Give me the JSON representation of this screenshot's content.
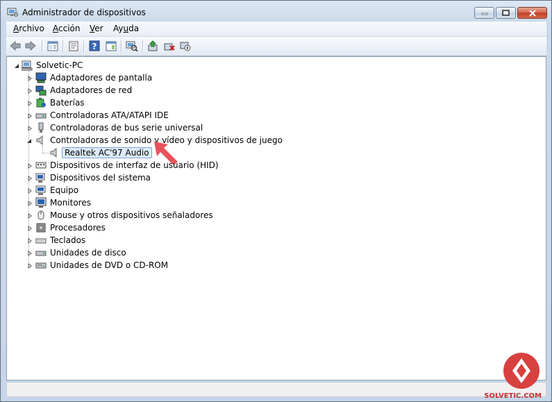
{
  "window": {
    "title": "Administrador de dispositivos",
    "accent": "#c6d6e8"
  },
  "menu": {
    "file": "Archivo",
    "action": "Acción",
    "view": "Ver",
    "help": "Ayuda"
  },
  "toolbar": {
    "icons": [
      "back-icon",
      "forward-icon",
      "show-hide-console-tree-icon",
      "properties-icon",
      "help-icon",
      "action-pane-icon",
      "scan-hardware-icon",
      "update-driver-icon",
      "uninstall-icon",
      "disable-icon"
    ]
  },
  "tree": {
    "root": "Solvetic-PC",
    "categories": [
      "Adaptadores de pantalla",
      "Adaptadores de red",
      "Baterías",
      "Controladoras ATA/ATAPI IDE",
      "Controladoras de bus serie universal",
      "Controladoras de sonido y vídeo y dispositivos de juego",
      "Dispositivos de interfaz de usuario (HID)",
      "Dispositivos del sistema",
      "Equipo",
      "Monitores",
      "Mouse y otros dispositivos señaladores",
      "Procesadores",
      "Teclados",
      "Unidades de disco",
      "Unidades de DVD o CD-ROM"
    ],
    "expanded_child": "Realtek AC'97 Audio"
  },
  "watermark": {
    "text": "SOLVETIC.COM",
    "color": "#d03030"
  }
}
